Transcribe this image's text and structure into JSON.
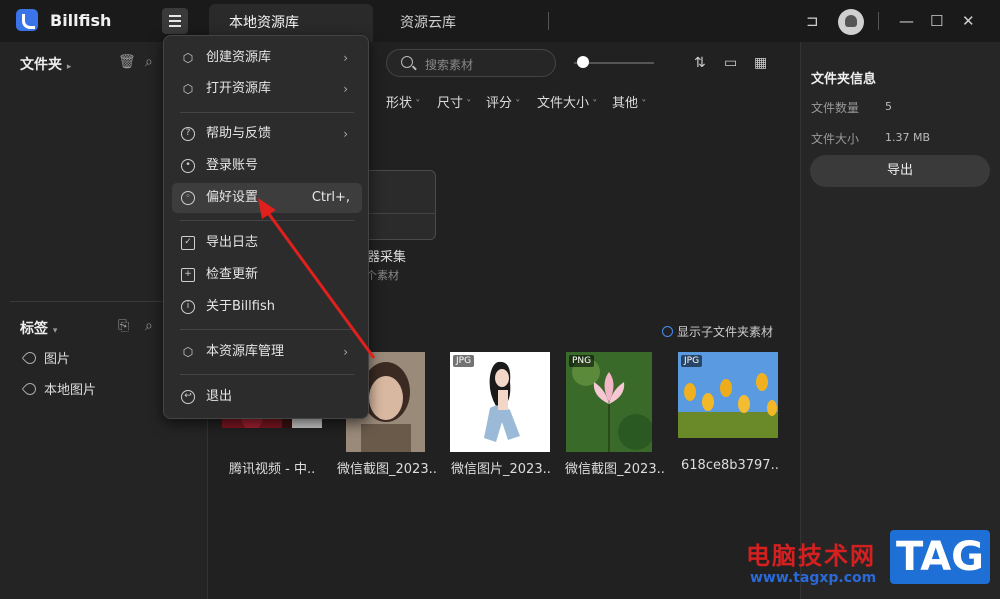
{
  "app": {
    "name": "Billfish"
  },
  "tabs": [
    {
      "label": "本地资源库"
    },
    {
      "label": "资源云库"
    }
  ],
  "sidebar": {
    "folders_heading": "文件夹",
    "tags_heading": "标签",
    "tags": [
      {
        "label": "图片"
      },
      {
        "label": "本地图片"
      }
    ]
  },
  "toolbar": {
    "search_placeholder": "搜索素材",
    "filters": [
      "形状",
      "尺寸",
      "评分",
      "文件大小",
      "其他"
    ]
  },
  "folder_card": {
    "name": "览器采集",
    "count": "个素材"
  },
  "content": {
    "show_subfolder": "显示子文件夹素材",
    "items": [
      {
        "label": "腾讯视频 - 中..",
        "badge": ""
      },
      {
        "label": "微信截图_2023..",
        "badge": ""
      },
      {
        "label": "微信图片_2023..",
        "badge": "JPG"
      },
      {
        "label": "微信截图_2023..",
        "badge": "PNG"
      },
      {
        "label": "618ce8b3797..",
        "badge": "JPG"
      }
    ]
  },
  "right_panel": {
    "title": "文件夹信息",
    "count_label": "文件数量",
    "count_value": "5",
    "size_label": "文件大小",
    "size_value": "1.37 MB",
    "export_label": "导出"
  },
  "menu": {
    "items": [
      {
        "label": "创建资源库",
        "icon": "cube-icon",
        "submenu": true
      },
      {
        "label": "打开资源库",
        "icon": "cube-icon",
        "submenu": true
      },
      {
        "label": "帮助与反馈",
        "icon": "help-icon",
        "submenu": true
      },
      {
        "label": "登录账号",
        "icon": "user-icon",
        "submenu": false
      },
      {
        "label": "偏好设置",
        "icon": "gear-icon",
        "submenu": false,
        "shortcut": "Ctrl+,",
        "active": true
      },
      {
        "label": "导出日志",
        "icon": "calendar-icon",
        "submenu": false
      },
      {
        "label": "检查更新",
        "icon": "update-icon",
        "submenu": false
      },
      {
        "label": "关于Billfish",
        "icon": "info-icon",
        "submenu": false
      },
      {
        "label": "本资源库管理",
        "icon": "cube-icon",
        "submenu": true
      },
      {
        "label": "退出",
        "icon": "logout-icon",
        "submenu": false
      }
    ]
  },
  "watermark": {
    "cn": "电脑技术网",
    "url": "www.tagxp.com",
    "tag": "TAG"
  },
  "colors": {
    "background": "#212121",
    "accent": "#3b74e8",
    "annotation_arrow": "#e0201c"
  }
}
